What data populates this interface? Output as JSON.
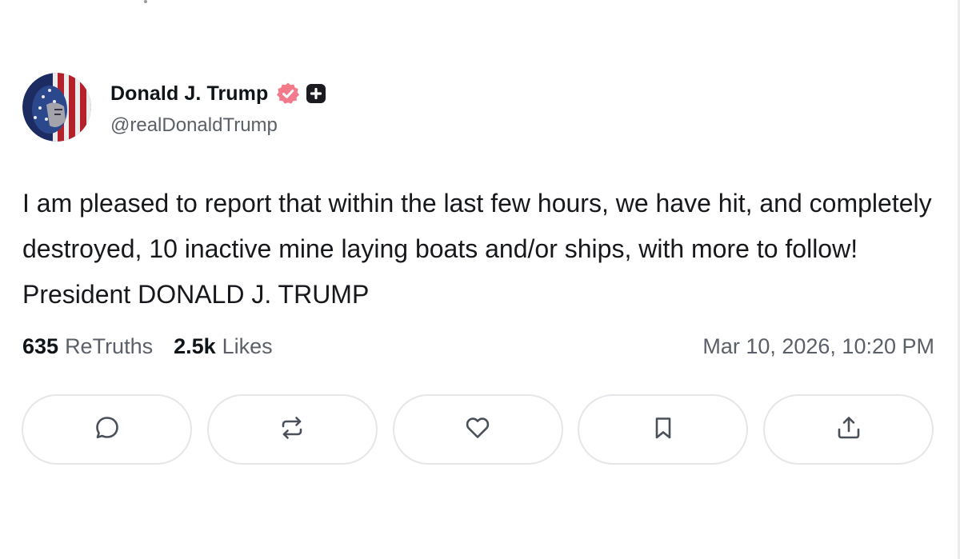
{
  "post": {
    "author_name": "Donald J. Trump",
    "handle": "@realDonaldTrump",
    "text": "I am pleased to report that within the last few hours, we have hit, and completely destroyed, 10 inactive mine laying boats and/or ships, with more to follow! President DONALD J. TRUMP",
    "retruths_count": "635",
    "retruths_label": "ReTruths",
    "likes_count": "2.5k",
    "likes_label": "Likes",
    "timestamp": "Mar 10, 2026, 10:20 PM"
  },
  "actions": [
    {
      "name": "reply",
      "icon": "comment-icon"
    },
    {
      "name": "retruth",
      "icon": "repost-icon"
    },
    {
      "name": "like",
      "icon": "heart-icon"
    },
    {
      "name": "bookmark",
      "icon": "bookmark-icon"
    },
    {
      "name": "share",
      "icon": "share-icon"
    }
  ],
  "colors": {
    "verified_badge": "#f27a8a",
    "plus_badge": "#1b1b20",
    "icon_stroke": "#4a505a",
    "secondary_text": "#5b6068",
    "border": "#e6e6ea"
  }
}
